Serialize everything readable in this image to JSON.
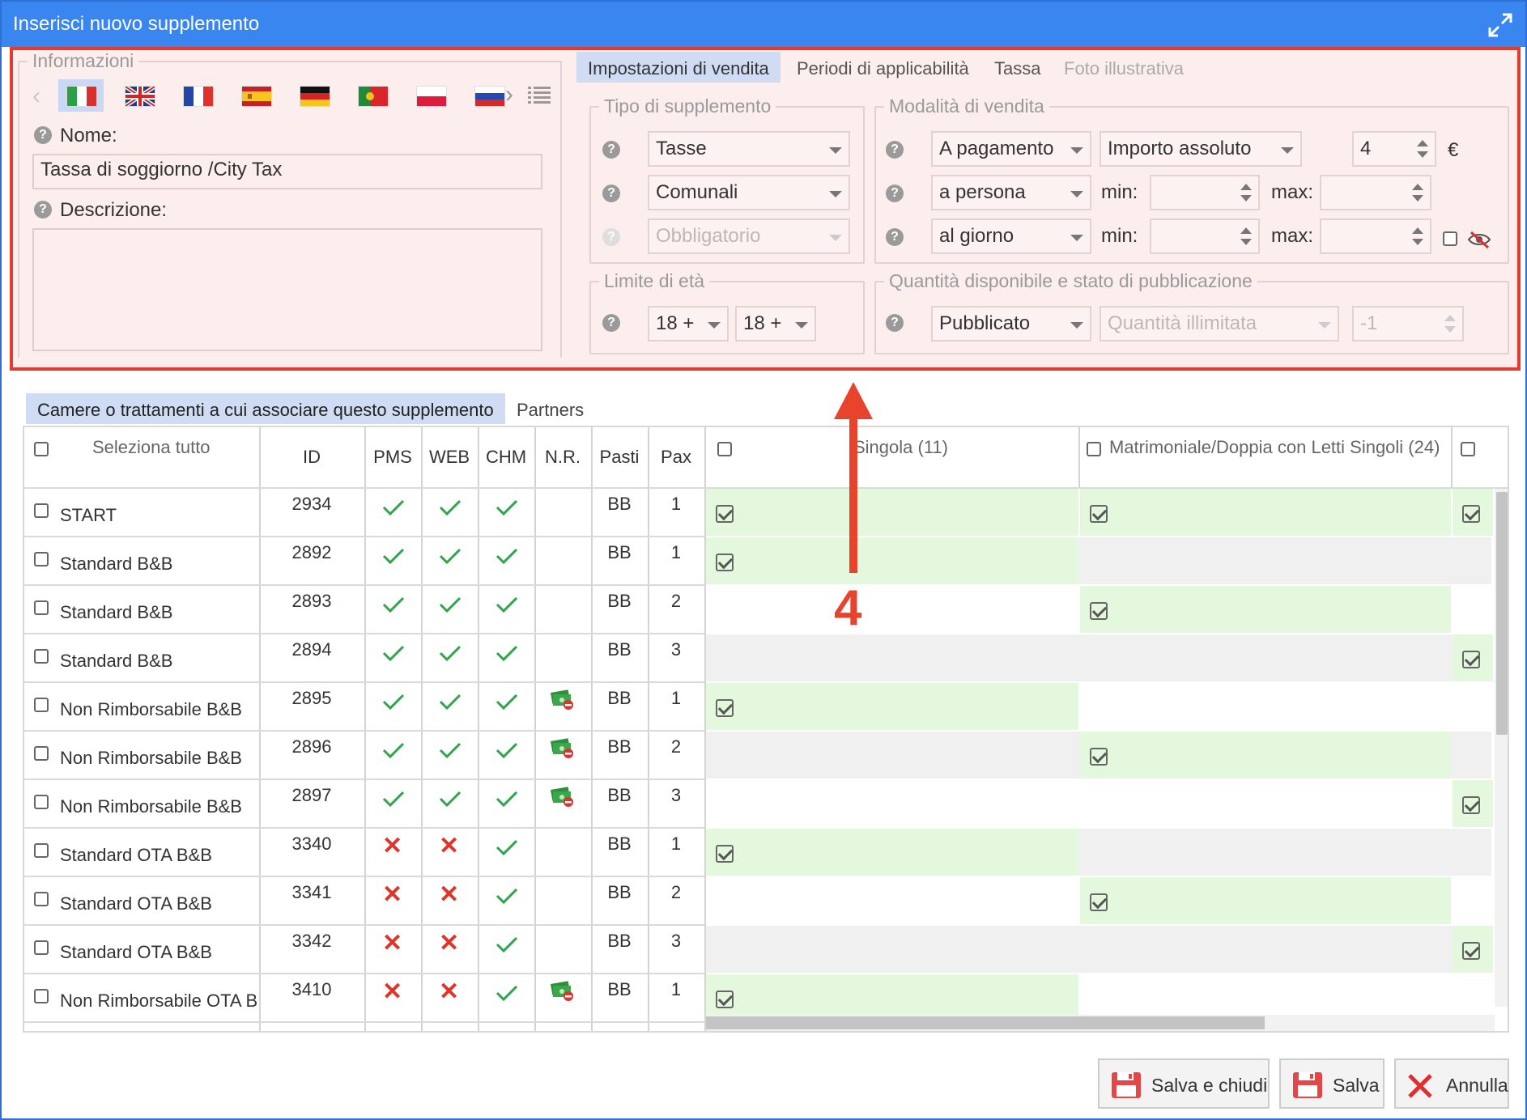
{
  "window": {
    "title": "Inserisci nuovo supplemento"
  },
  "info": {
    "legend": "Informazioni",
    "name_label": "Nome:",
    "name_value": "Tassa di soggiorno /City Tax",
    "desc_label": "Descrizione:",
    "languages": [
      "Italiano",
      "English",
      "Français",
      "Español",
      "Deutsch",
      "Português",
      "Polski",
      "Русский"
    ]
  },
  "tabs": [
    "Impostazioni di vendita",
    "Periodi di applicabilità",
    "Tassa",
    "Foto illustrativa"
  ],
  "tipo": {
    "legend": "Tipo di supplemento",
    "type": "Tasse",
    "sub": "Comunali",
    "mand": "Obbligatorio"
  },
  "vendita": {
    "legend": "Modalità di vendita",
    "payment": "A pagamento",
    "amount_type": "Importo assoluto",
    "amount": "4",
    "currency": "€",
    "per": "a persona",
    "freq": "al giorno",
    "min_label": "min:",
    "max_label": "max:"
  },
  "eta": {
    "legend": "Limite di età",
    "from": "18 +",
    "to": "18 +"
  },
  "pub": {
    "legend": "Quantità disponibile e stato di pubblicazione",
    "status": "Pubblicato",
    "qty": "Quantità illimitata",
    "qty_val": "-1"
  },
  "annotation": "4",
  "lower_tabs": [
    "Camere o trattamenti a cui associare questo supplemento",
    "Partners"
  ],
  "grid": {
    "headers": {
      "select_all": "Seleziona tutto",
      "id": "ID",
      "pms": "PMS",
      "web": "WEB",
      "chm": "CHM",
      "nr": "N.R.",
      "pasti": "Pasti",
      "pax": "Pax"
    },
    "room_cols": [
      "Singola (11)",
      "Matrimoniale/Doppia con Letti Singoli (24)"
    ],
    "rows": [
      {
        "name": "START",
        "id": "2934",
        "pms": "ok",
        "web": "ok",
        "chm": "ok",
        "nr": false,
        "pasti": "BB",
        "pax": "1"
      },
      {
        "name": "Standard B&B",
        "id": "2892",
        "pms": "ok",
        "web": "ok",
        "chm": "ok",
        "nr": false,
        "pasti": "BB",
        "pax": "1"
      },
      {
        "name": "Standard B&B",
        "id": "2893",
        "pms": "ok",
        "web": "ok",
        "chm": "ok",
        "nr": false,
        "pasti": "BB",
        "pax": "2"
      },
      {
        "name": "Standard B&B",
        "id": "2894",
        "pms": "ok",
        "web": "ok",
        "chm": "ok",
        "nr": false,
        "pasti": "BB",
        "pax": "3"
      },
      {
        "name": "Non Rimborsabile B&B",
        "id": "2895",
        "pms": "ok",
        "web": "ok",
        "chm": "ok",
        "nr": true,
        "pasti": "BB",
        "pax": "1"
      },
      {
        "name": "Non Rimborsabile B&B",
        "id": "2896",
        "pms": "ok",
        "web": "ok",
        "chm": "ok",
        "nr": true,
        "pasti": "BB",
        "pax": "2"
      },
      {
        "name": "Non Rimborsabile B&B",
        "id": "2897",
        "pms": "ok",
        "web": "ok",
        "chm": "ok",
        "nr": true,
        "pasti": "BB",
        "pax": "3"
      },
      {
        "name": "Standard OTA B&B",
        "id": "3340",
        "pms": "no",
        "web": "no",
        "chm": "ok",
        "nr": false,
        "pasti": "BB",
        "pax": "1"
      },
      {
        "name": "Standard OTA B&B",
        "id": "3341",
        "pms": "no",
        "web": "no",
        "chm": "ok",
        "nr": false,
        "pasti": "BB",
        "pax": "2"
      },
      {
        "name": "Standard OTA B&B",
        "id": "3342",
        "pms": "no",
        "web": "no",
        "chm": "ok",
        "nr": false,
        "pasti": "BB",
        "pax": "3"
      },
      {
        "name": "Non Rimborsabile OTA B&",
        "id": "3410",
        "pms": "no",
        "web": "no",
        "chm": "ok",
        "nr": true,
        "pasti": "BB",
        "pax": "1"
      }
    ]
  },
  "buttons": {
    "save_close": "Salva e chiudi",
    "save": "Salva",
    "cancel": "Annulla"
  }
}
